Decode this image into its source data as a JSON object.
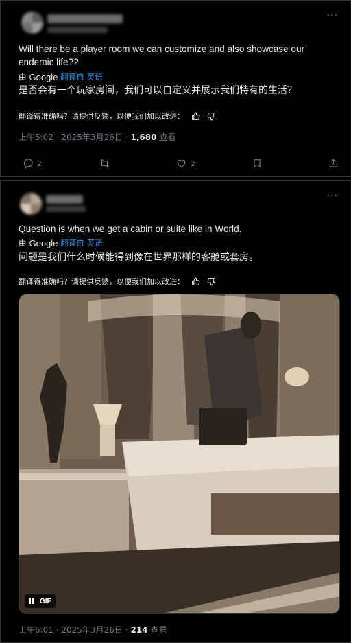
{
  "post1": {
    "more_label": "···",
    "text_en": "Will there be a player room we can customize and also showcase our endemic life??",
    "translated_by": "由",
    "google_label": "Google",
    "translated_from": "翻译自 英语",
    "text_zh": "是否会有一个玩家房间，我们可以自定义并展示我们特有的生活？",
    "feedback_prompt": "翻译得准确吗？请提供反馈，以便我们加以改进：",
    "time": "上午5:02 · 2025年3月26日 ·",
    "views_count": "1,680",
    "views_label": "查看",
    "replies": "2",
    "likes": "2"
  },
  "post2": {
    "more_label": "···",
    "text_en": "Question is when we get a cabin or suite like in World.",
    "translated_by": "由",
    "google_label": "Google",
    "translated_from": "翻译自 英语",
    "text_zh": "问题是我们什么时候能得到像在世界那样的客舱或套房。",
    "feedback_prompt": "翻译得准确吗？请提供反馈，以便我们加以改进：",
    "gif_label": "GIF",
    "time": "上午6:01 · 2025年3月26日 ·",
    "views_count": "214",
    "views_label": "查看"
  },
  "colors": {
    "background": "#000000",
    "text": "#e7e9ea",
    "muted": "#71767b",
    "link": "#1d9bf0",
    "border": "#2f3336"
  }
}
